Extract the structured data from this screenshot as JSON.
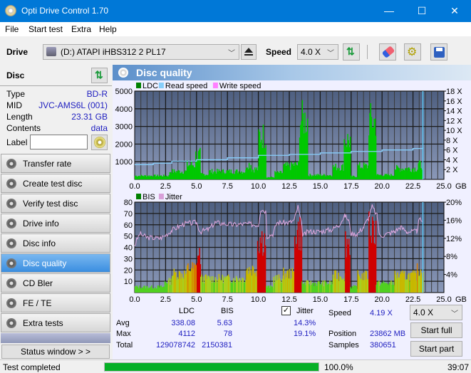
{
  "window": {
    "title": "Opti Drive Control 1.70",
    "minimize": "—",
    "maximize": "☐",
    "close": "✕"
  },
  "menu": [
    "File",
    "Start test",
    "Extra",
    "Help"
  ],
  "toolbar": {
    "drive_label": "Drive",
    "drive_value": "(D:)  ATAPI iHBS312  2 PL17",
    "speed_label": "Speed",
    "speed_value": "4.0 X"
  },
  "disc": {
    "header": "Disc",
    "rows": [
      {
        "label": "Type",
        "value": "BD-R"
      },
      {
        "label": "MID",
        "value": "JVC-AMS6L (001)"
      },
      {
        "label": "Length",
        "value": "23.31 GB"
      },
      {
        "label": "Contents",
        "value": "data"
      }
    ],
    "label_field": "Label",
    "label_value": ""
  },
  "nav": [
    {
      "label": "Transfer rate",
      "active": false
    },
    {
      "label": "Create test disc",
      "active": false
    },
    {
      "label": "Verify test disc",
      "active": false
    },
    {
      "label": "Drive info",
      "active": false
    },
    {
      "label": "Disc info",
      "active": false
    },
    {
      "label": "Disc quality",
      "active": true
    },
    {
      "label": "CD Bler",
      "active": false
    },
    {
      "label": "FE / TE",
      "active": false
    },
    {
      "label": "Extra tests",
      "active": false
    }
  ],
  "status_window_btn": "Status window > >",
  "section_title": "Disc quality",
  "chart_data": [
    {
      "type": "bar",
      "title": "LDC / Read speed",
      "legend": [
        "LDC",
        "Read speed",
        "Write speed"
      ],
      "legend_colors": [
        "#008000",
        "#87cefa",
        "#ff80ff"
      ],
      "x_unit": "GB",
      "xlim": [
        0,
        25
      ],
      "x_ticks": [
        "0.0",
        "2.5",
        "5.0",
        "7.5",
        "10.0",
        "12.5",
        "15.0",
        "17.5",
        "20.0",
        "22.5",
        "25.0"
      ],
      "ylim": [
        0,
        5000
      ],
      "y_ticks": [
        "1000",
        "2000",
        "3000",
        "4000",
        "5000"
      ],
      "y2lim": [
        0,
        18
      ],
      "y2_ticks": [
        "2 X",
        "4 X",
        "6 X",
        "8 X",
        "10 X",
        "12 X",
        "14 X",
        "16 X",
        "18 X"
      ],
      "ldc_segments": [
        {
          "x0": 0.0,
          "x1": 2.8,
          "v": 250
        },
        {
          "x0": 2.8,
          "x1": 4.2,
          "v": 550
        },
        {
          "x0": 4.2,
          "x1": 4.9,
          "v": 1000
        },
        {
          "x0": 4.9,
          "x1": 5.3,
          "v": 1650
        },
        {
          "x0": 5.3,
          "x1": 6.0,
          "v": 350
        },
        {
          "x0": 6.0,
          "x1": 9.0,
          "v": 550
        },
        {
          "x0": 9.0,
          "x1": 9.4,
          "v": 1050
        },
        {
          "x0": 9.4,
          "x1": 10.0,
          "v": 700
        },
        {
          "x0": 10.0,
          "x1": 10.6,
          "v": 3000
        },
        {
          "x0": 10.6,
          "x1": 11.3,
          "v": 150
        },
        {
          "x0": 11.3,
          "x1": 12.0,
          "v": 450
        },
        {
          "x0": 12.0,
          "x1": 12.7,
          "v": 900
        },
        {
          "x0": 12.7,
          "x1": 13.3,
          "v": 1000
        },
        {
          "x0": 13.3,
          "x1": 14.0,
          "v": 4100
        },
        {
          "x0": 14.0,
          "x1": 16.0,
          "v": 300
        },
        {
          "x0": 16.0,
          "x1": 16.9,
          "v": 850
        },
        {
          "x0": 16.9,
          "x1": 17.4,
          "v": 2700
        },
        {
          "x0": 17.4,
          "x1": 18.0,
          "v": 200
        },
        {
          "x0": 18.0,
          "x1": 18.9,
          "v": 900
        },
        {
          "x0": 18.9,
          "x1": 19.5,
          "v": 4000
        },
        {
          "x0": 19.5,
          "x1": 21.0,
          "v": 300
        },
        {
          "x0": 21.0,
          "x1": 22.9,
          "v": 750
        },
        {
          "x0": 22.9,
          "x1": 23.3,
          "v": 1000
        }
      ],
      "read_speed": [
        [
          0,
          3.0
        ],
        [
          1.5,
          3.3
        ],
        [
          3,
          3.7
        ],
        [
          5,
          4.0
        ],
        [
          7.5,
          4.4
        ],
        [
          10,
          4.9
        ],
        [
          12.5,
          5.1
        ],
        [
          15,
          5.4
        ],
        [
          17.5,
          5.7
        ],
        [
          20,
          6.0
        ],
        [
          22.5,
          6.3
        ],
        [
          23.3,
          6.6
        ]
      ],
      "position_marker_gb": 23.3
    },
    {
      "type": "bar",
      "title": "BIS / Jitter",
      "legend": [
        "BIS",
        "Jitter"
      ],
      "legend_colors": [
        "#008000",
        "#d8a0d8"
      ],
      "x_unit": "GB",
      "xlim": [
        0,
        25
      ],
      "x_ticks": [
        "0.0",
        "2.5",
        "5.0",
        "7.5",
        "10.0",
        "12.5",
        "15.0",
        "17.5",
        "20.0",
        "22.5",
        "25.0"
      ],
      "ylim": [
        0,
        80
      ],
      "y_ticks": [
        "10",
        "20",
        "30",
        "40",
        "50",
        "60",
        "70",
        "80"
      ],
      "y2lim": [
        0,
        20
      ],
      "y2_ticks": [
        "4%",
        "8%",
        "12%",
        "16%",
        "20%"
      ],
      "bis_segments": [
        {
          "x0": 0.0,
          "x1": 2.4,
          "v": 6
        },
        {
          "x0": 2.4,
          "x1": 3.0,
          "v": 12
        },
        {
          "x0": 3.0,
          "x1": 4.2,
          "v": 20
        },
        {
          "x0": 4.2,
          "x1": 5.0,
          "v": 26
        },
        {
          "x0": 5.0,
          "x1": 5.3,
          "v": 40
        },
        {
          "x0": 5.3,
          "x1": 9.0,
          "v": 15
        },
        {
          "x0": 9.0,
          "x1": 9.9,
          "v": 25
        },
        {
          "x0": 9.9,
          "x1": 10.6,
          "v": 58
        },
        {
          "x0": 10.6,
          "x1": 11.2,
          "v": 6
        },
        {
          "x0": 11.2,
          "x1": 12.0,
          "v": 15
        },
        {
          "x0": 12.0,
          "x1": 12.9,
          "v": 20
        },
        {
          "x0": 12.9,
          "x1": 13.5,
          "v": 65
        },
        {
          "x0": 13.5,
          "x1": 16.0,
          "v": 10
        },
        {
          "x0": 16.0,
          "x1": 17.0,
          "v": 18
        },
        {
          "x0": 17.0,
          "x1": 17.4,
          "v": 55
        },
        {
          "x0": 17.4,
          "x1": 18.0,
          "v": 6
        },
        {
          "x0": 18.0,
          "x1": 18.9,
          "v": 18
        },
        {
          "x0": 18.9,
          "x1": 19.5,
          "v": 70
        },
        {
          "x0": 19.5,
          "x1": 21.0,
          "v": 10
        },
        {
          "x0": 21.0,
          "x1": 22.8,
          "v": 18
        },
        {
          "x0": 22.8,
          "x1": 23.3,
          "v": 24
        }
      ],
      "jitter": [
        [
          0,
          10.5
        ],
        [
          0.4,
          13
        ],
        [
          1,
          12.2
        ],
        [
          2,
          12
        ],
        [
          2.4,
          12.5
        ],
        [
          3,
          13.8
        ],
        [
          4,
          15.2
        ],
        [
          5,
          15.5
        ],
        [
          5.3,
          13.5
        ],
        [
          6,
          14
        ],
        [
          6.5,
          15.5
        ],
        [
          8,
          15
        ],
        [
          9,
          15.2
        ],
        [
          10,
          15
        ],
        [
          10.2,
          18.5
        ],
        [
          10.6,
          18
        ],
        [
          10.7,
          12.5
        ],
        [
          11.2,
          13
        ],
        [
          11.5,
          15.5
        ],
        [
          12.5,
          15.5
        ],
        [
          12.9,
          16
        ],
        [
          13.2,
          19
        ],
        [
          13.5,
          15
        ],
        [
          13.6,
          12.5
        ],
        [
          14,
          13.5
        ],
        [
          15,
          13.5
        ],
        [
          16,
          14
        ],
        [
          16.5,
          15
        ],
        [
          17,
          17
        ],
        [
          17.3,
          16
        ],
        [
          17.5,
          13
        ],
        [
          18,
          13
        ],
        [
          18.5,
          14.5
        ],
        [
          18.9,
          16.5
        ],
        [
          19.2,
          19
        ],
        [
          19.6,
          17
        ],
        [
          19.8,
          12.5
        ],
        [
          21,
          13.5
        ],
        [
          21.5,
          14.5
        ],
        [
          22,
          13.5
        ],
        [
          22.8,
          13.5
        ],
        [
          23.0,
          16
        ],
        [
          23.3,
          16
        ]
      ],
      "position_marker_gb": 23.3
    }
  ],
  "stats": {
    "col_ldc": "LDC",
    "col_bis": "BIS",
    "rows": [
      {
        "label": "Avg",
        "ldc": "338.08",
        "bis": "5.63",
        "jitter": "14.3%"
      },
      {
        "label": "Max",
        "ldc": "4112",
        "bis": "78",
        "jitter": "19.1%"
      },
      {
        "label": "Total",
        "ldc": "129078742",
        "bis": "2150381",
        "jitter": ""
      }
    ],
    "jitter_label": "Jitter",
    "jitter_checked": true,
    "speed_label": "Speed",
    "speed_value": "4.19 X",
    "position_label": "Position",
    "position_value": "23862 MB",
    "samples_label": "Samples",
    "samples_value": "380651",
    "speed_select": "4.0 X",
    "start_full": "Start full",
    "start_part": "Start part"
  },
  "status": {
    "text": "Test completed",
    "progress_pct": 100,
    "progress_label": "100.0%",
    "time": "39:07"
  }
}
